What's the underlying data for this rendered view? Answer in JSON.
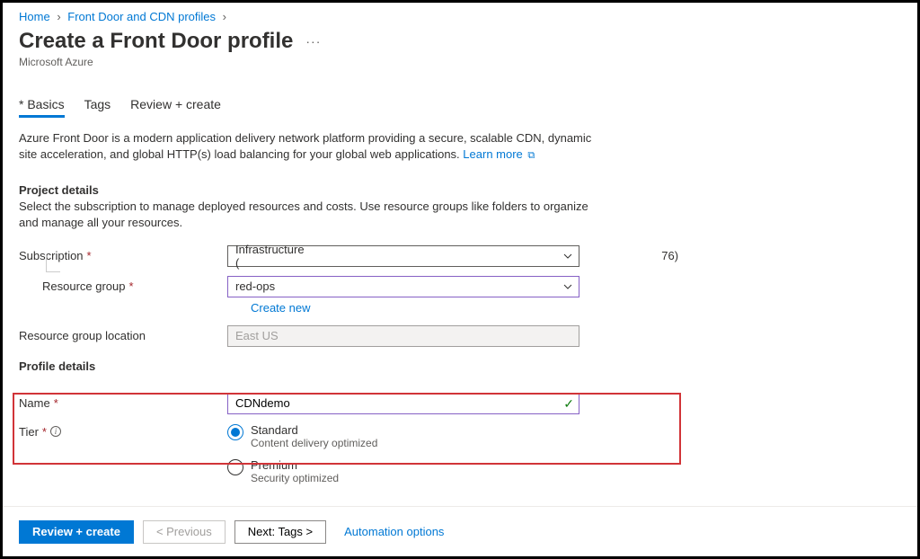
{
  "breadcrumb": {
    "home": "Home",
    "profiles": "Front Door and CDN profiles"
  },
  "title": "Create a Front Door profile",
  "subtitle": "Microsoft Azure",
  "tabs": {
    "basics": "Basics",
    "tags": "Tags",
    "review": "Review + create"
  },
  "intro": {
    "text": "Azure Front Door is a modern application delivery network platform providing a secure, scalable CDN, dynamic site acceleration, and global HTTP(s) load balancing for your global web applications.",
    "learn_more": "Learn more"
  },
  "project": {
    "heading": "Project details",
    "sub": "Select the subscription to manage deployed resources and costs. Use resource groups like folders to organize and manage all your resources.",
    "subscription_label": "Subscription",
    "subscription_value_prefix": "Infrastructure (",
    "subscription_value_suffix": "76)",
    "rg_label": "Resource group",
    "rg_value": "red-ops",
    "create_new": "Create new",
    "location_label": "Resource group location",
    "location_value": "East US"
  },
  "profile": {
    "heading": "Profile details",
    "name_label": "Name",
    "name_value": "CDNdemo",
    "tier_label": "Tier",
    "standard_title": "Standard",
    "standard_sub": "Content delivery optimized",
    "premium_title": "Premium",
    "premium_sub": "Security optimized"
  },
  "footer": {
    "review": "Review + create",
    "previous": "< Previous",
    "next": "Next: Tags >",
    "automation": "Automation options"
  }
}
